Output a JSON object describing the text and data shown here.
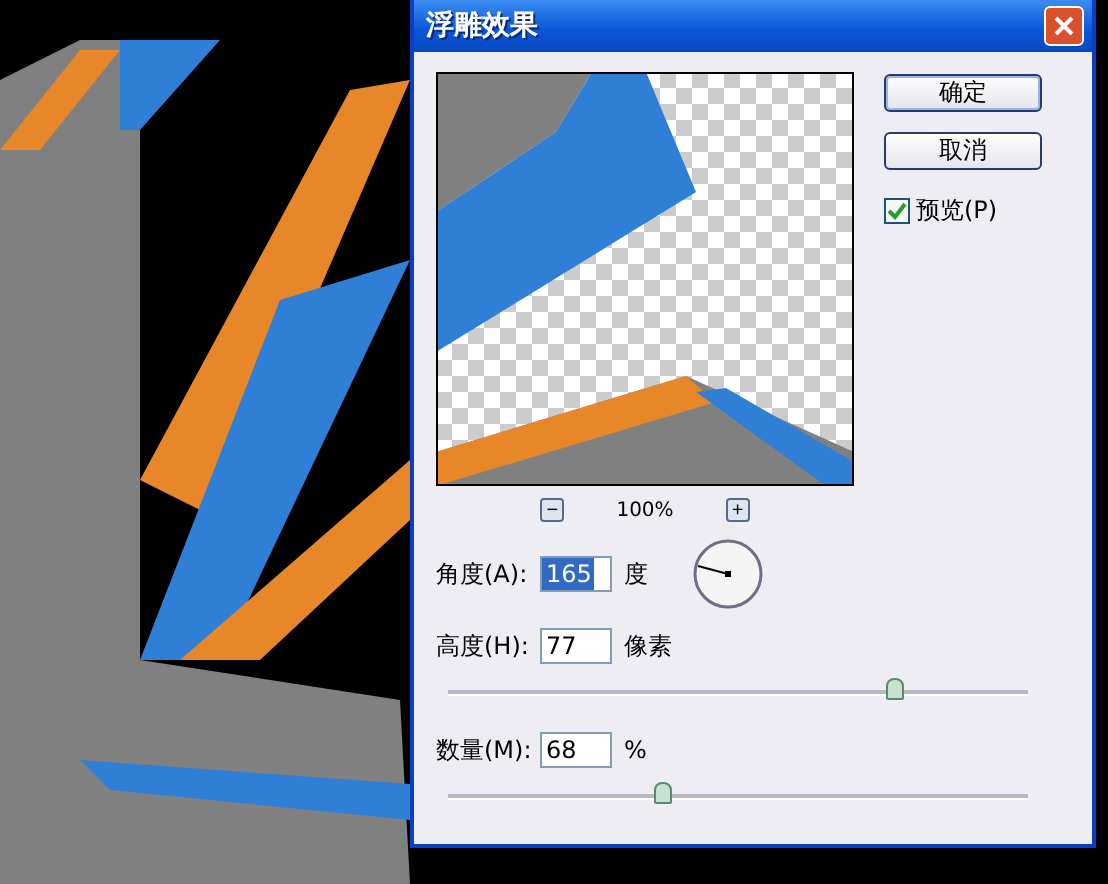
{
  "window": {
    "title": "浮雕效果"
  },
  "preview": {
    "zoom": "100%",
    "zoom_out": "−",
    "zoom_in": "+"
  },
  "buttons": [
    {
      "label": "确定",
      "default": true
    },
    {
      "label": "取消",
      "default": false
    }
  ],
  "preview_checkbox": {
    "label": "预览(P)",
    "checked": true
  },
  "angle": {
    "label": "角度(A):",
    "value": "165",
    "unit": "度"
  },
  "height": {
    "label": "高度(H):",
    "value": "77",
    "unit": "像素",
    "level": 0.77
  },
  "amount": {
    "label": "数量(M):",
    "value": "68",
    "unit": "%",
    "level": 0.37
  }
}
